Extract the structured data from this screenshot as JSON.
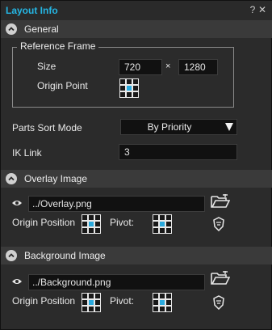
{
  "window": {
    "title": "Layout Info",
    "help_label": "?",
    "close_label": "✕"
  },
  "general": {
    "header": "General",
    "reference_frame": {
      "legend": "Reference Frame",
      "size_label": "Size",
      "width": "720",
      "times": "×",
      "height": "1280",
      "origin_label": "Origin Point"
    },
    "parts_sort_mode": {
      "label": "Parts Sort Mode",
      "value": "By Priority"
    },
    "ik_link": {
      "label": "IK Link",
      "value": "3"
    }
  },
  "overlay": {
    "header": "Overlay Image",
    "path": "../Overlay.png",
    "origin_position_label": "Origin Position",
    "pivot_label": "Pivot:"
  },
  "background": {
    "header": "Background Image",
    "path": "../Background.png",
    "origin_position_label": "Origin Position",
    "pivot_label": "Pivot:"
  },
  "colors": {
    "accent": "#25b6e4",
    "panel": "#2b2b2b",
    "header": "#3a3a3a",
    "field": "#111111"
  },
  "icons": [
    "help-icon",
    "close-icon",
    "collapse-icon",
    "eye-icon",
    "folder-open-icon",
    "reset-icon",
    "anchor-grid-icon",
    "dropdown-arrow-icon"
  ]
}
